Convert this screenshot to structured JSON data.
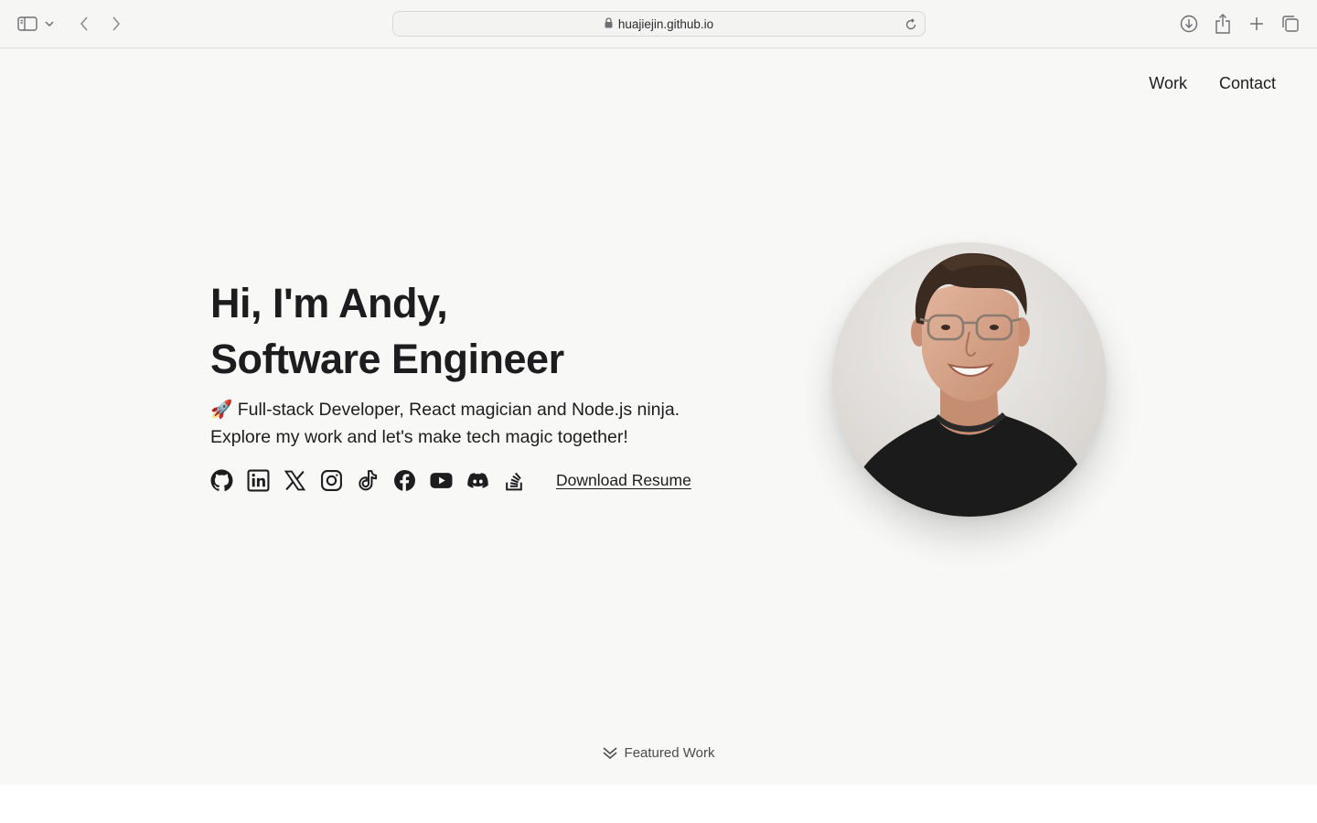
{
  "browser": {
    "url": "huajiejin.github.io",
    "icons": [
      "sidebar-icon",
      "chevron-down-icon",
      "back-icon",
      "forward-icon",
      "lock-icon",
      "reload-icon",
      "download-icon",
      "share-icon",
      "new-tab-icon",
      "tabs-overview-icon"
    ]
  },
  "nav": {
    "work": "Work",
    "contact": "Contact"
  },
  "hero": {
    "title_line1": "Hi, I'm Andy,",
    "title_line2": "Software Engineer",
    "tagline_line1": "🚀 Full-stack Developer, React magician and Node.js ninja.",
    "tagline_line2": "Explore my work and let's make tech magic together!",
    "resume_label": "Download Resume"
  },
  "socials": [
    "github-icon",
    "linkedin-icon",
    "x-icon",
    "instagram-icon",
    "tiktok-icon",
    "facebook-icon",
    "youtube-icon",
    "discord-icon",
    "stackoverflow-icon"
  ],
  "featured": {
    "label": "Featured Work",
    "icon": "double-chevron-down-icon"
  },
  "colors": {
    "page_bg": "#f8f8f6",
    "text": "#1d1d1f",
    "chrome_bg": "#f6f6f5"
  }
}
